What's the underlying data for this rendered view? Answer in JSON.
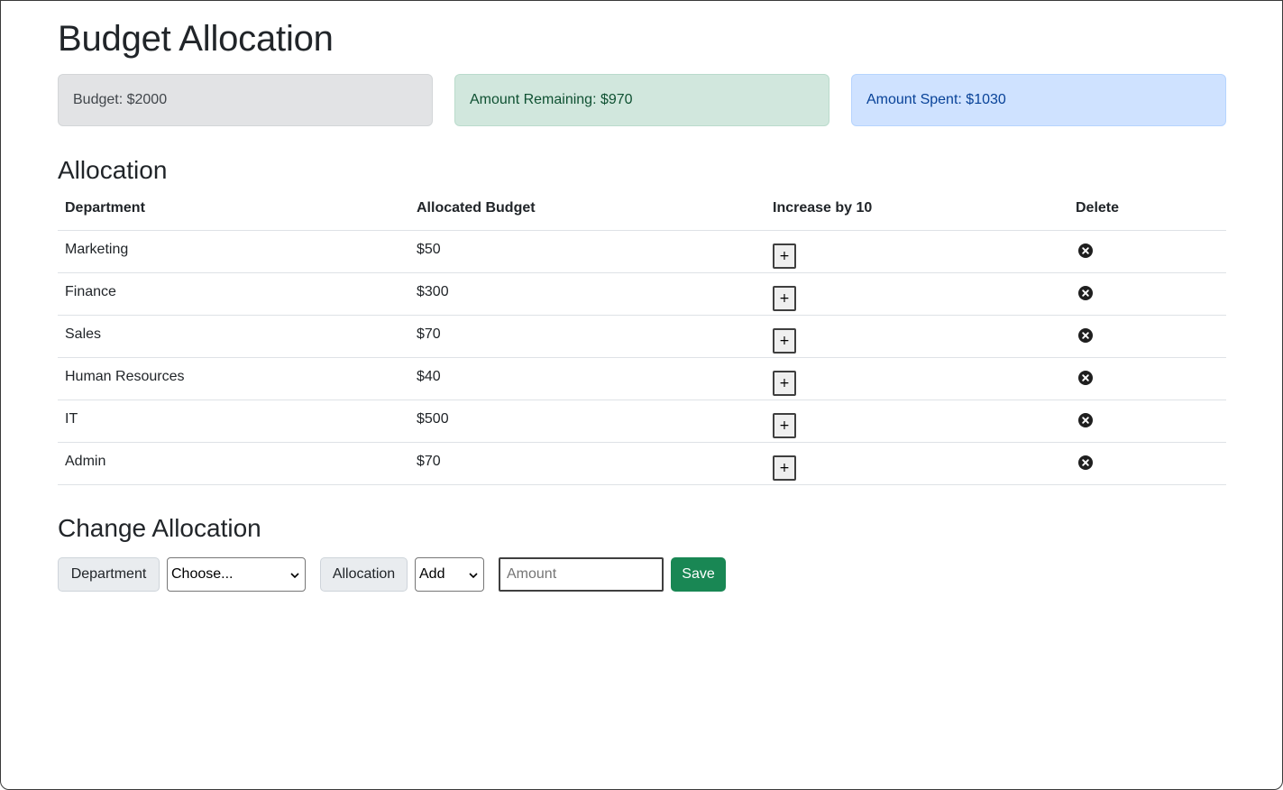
{
  "page": {
    "title": "Budget Allocation"
  },
  "summary": {
    "budget": "Budget: $2000",
    "remaining": "Amount Remaining: $970",
    "spent": "Amount Spent: $1030",
    "colors": {
      "budget_bg": "#e2e3e5",
      "remaining_bg": "#d1e7dd",
      "spent_bg": "#cfe2ff"
    }
  },
  "allocation": {
    "heading": "Allocation",
    "columns": [
      "Department",
      "Allocated Budget",
      "Increase by 10",
      "Delete"
    ],
    "rows": [
      {
        "department": "Marketing",
        "budget": "$50",
        "increase_label": "+",
        "delete_icon": "x-circle-icon"
      },
      {
        "department": "Finance",
        "budget": "$300",
        "increase_label": "+",
        "delete_icon": "x-circle-icon"
      },
      {
        "department": "Sales",
        "budget": "$70",
        "increase_label": "+",
        "delete_icon": "x-circle-icon"
      },
      {
        "department": "Human Resources",
        "budget": "$40",
        "increase_label": "+",
        "delete_icon": "x-circle-icon"
      },
      {
        "department": "IT",
        "budget": "$500",
        "increase_label": "+",
        "delete_icon": "x-circle-icon"
      },
      {
        "department": "Admin",
        "budget": "$70",
        "increase_label": "+",
        "delete_icon": "x-circle-icon"
      }
    ]
  },
  "change": {
    "heading": "Change Allocation",
    "department_label": "Department",
    "department_select": "Choose...",
    "allocation_label": "Allocation",
    "action_select": "Add",
    "amount_placeholder": "Amount",
    "save_label": "Save",
    "save_color": "#198754"
  }
}
